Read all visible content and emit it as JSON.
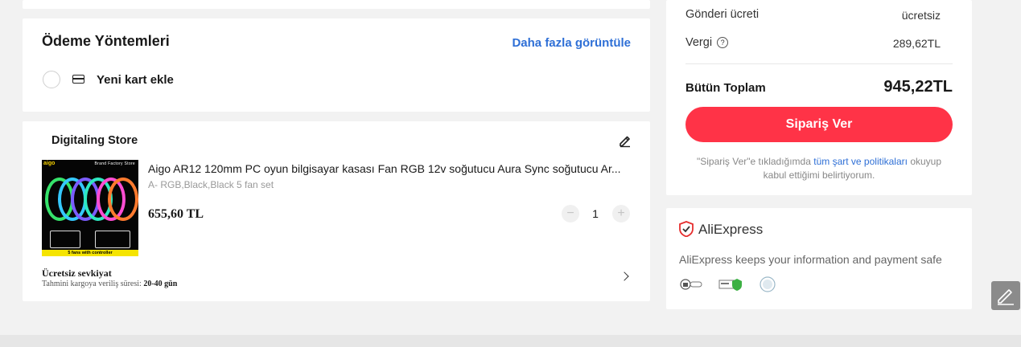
{
  "payment": {
    "title": "Ödeme Yöntemleri",
    "more_link": "Daha fazla görüntüle",
    "new_card_label": "Yeni kart ekle"
  },
  "store": {
    "name": "Digitaling Store",
    "product": {
      "title": "Aigo AR12 120mm PC oyun bilgisayar kasası Fan RGB 12v soğutucu Aura Sync soğutucu Ar...",
      "variant": "A- RGB,Black,Black 5 fan set",
      "price": "655,60 TL",
      "quantity": "1",
      "image_text": {
        "brand": "aigo",
        "store_banner": "Brand Factory Store",
        "bottom_banner": "5 fans with controller"
      }
    },
    "shipping": {
      "title": "Ücretsiz sevkiyat",
      "estimate_label": "Tahmini kargoya veriliş süresi:",
      "estimate_value": "20-40 gün"
    }
  },
  "summary": {
    "shipping_label": "Gönderi ücreti",
    "shipping_value": "ücretsiz",
    "tax_label": "Vergi",
    "tax_value": "289,62TL",
    "total_label": "Bütün Toplam",
    "total_value": "945,22TL",
    "order_button": "Sipariş Ver",
    "terms_prefix": "\"Sipariş Ver\"e tıkladığımda",
    "terms_link": "tüm şart ve politikaları",
    "terms_suffix": "okuyup kabul ettiğimi belirtiyorum."
  },
  "trust": {
    "brand": "AliExpress",
    "message": "AliExpress keeps your information and payment safe"
  },
  "colors": {
    "accent_red": "#ff3347",
    "link_blue": "#2e6fd6"
  }
}
